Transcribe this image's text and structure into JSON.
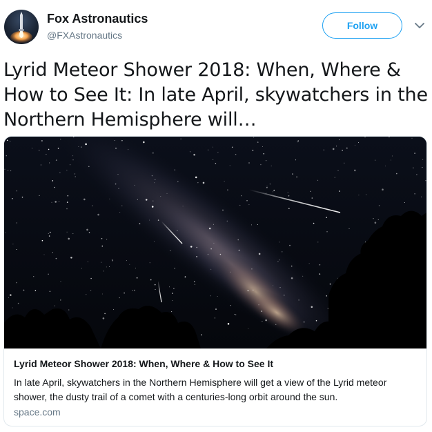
{
  "author": {
    "name": "Fox Astronautics",
    "handle": "@FXAstronautics",
    "avatar_icon": "rocket-launch-icon"
  },
  "actions": {
    "follow_label": "Follow",
    "menu_icon": "chevron-down-icon"
  },
  "tweet": {
    "text": "Lyrid Meteor Shower 2018: When, Where & How to See It: In late April, skywatchers in the Northern Hemisphere will…"
  },
  "card": {
    "title": "Lyrid Meteor Shower 2018: When, Where & How to See It",
    "description": "In late April, skywatchers in the Northern Hemisphere will get a view of the Lyrid meteor shower, the dusty trail of a comet with a centuries-long orbit around the sun.",
    "domain": "space.com"
  },
  "colors": {
    "accent": "#1da1f2",
    "text": "#14171a",
    "secondary": "#657786",
    "border": "#e1e8ed"
  }
}
